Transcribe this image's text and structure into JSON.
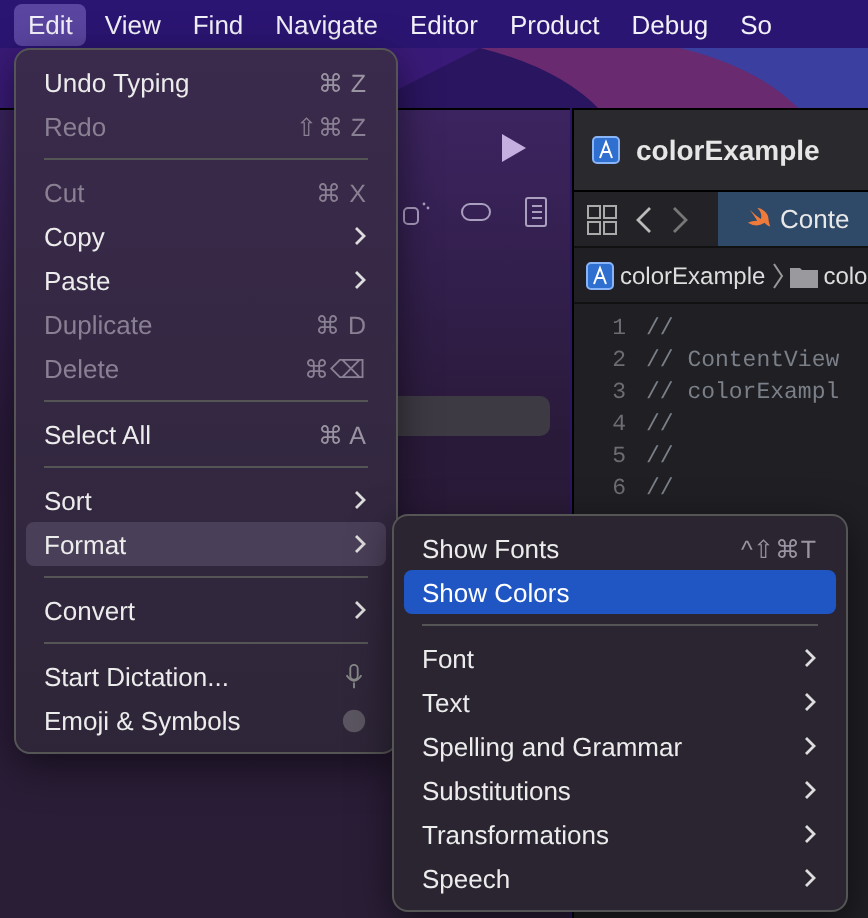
{
  "menubar": {
    "items": [
      {
        "label": "Edit",
        "selected": true
      },
      {
        "label": "View",
        "selected": false
      },
      {
        "label": "Find",
        "selected": false
      },
      {
        "label": "Navigate",
        "selected": false
      },
      {
        "label": "Editor",
        "selected": false
      },
      {
        "label": "Product",
        "selected": false
      },
      {
        "label": "Debug",
        "selected": false
      },
      {
        "label": "So",
        "selected": false
      }
    ]
  },
  "xcode": {
    "project_title": "colorExample",
    "tab": "Conte",
    "breadcrumb": [
      "colorExample",
      "colo"
    ],
    "code_lines": [
      {
        "number": "1",
        "text": "//"
      },
      {
        "number": "2",
        "text": "//  ContentView"
      },
      {
        "number": "3",
        "text": "//  colorExampl"
      },
      {
        "number": "4",
        "text": "//"
      },
      {
        "number": "5",
        "text": "//"
      },
      {
        "number": "6",
        "text": "//"
      }
    ]
  },
  "edit_menu": {
    "items": [
      {
        "kind": "item",
        "label": "Undo Typing",
        "shortcut": "⌘ Z",
        "disabled": false,
        "submenu": false,
        "selected": false
      },
      {
        "kind": "item",
        "label": "Redo",
        "shortcut": "⇧⌘ Z",
        "disabled": true,
        "submenu": false,
        "selected": false
      },
      {
        "kind": "separator"
      },
      {
        "kind": "item",
        "label": "Cut",
        "shortcut": "⌘ X",
        "disabled": true,
        "submenu": false,
        "selected": false
      },
      {
        "kind": "item",
        "label": "Copy",
        "disabled": false,
        "submenu": true,
        "selected": false
      },
      {
        "kind": "item",
        "label": "Paste",
        "disabled": false,
        "submenu": true,
        "selected": false
      },
      {
        "kind": "item",
        "label": "Duplicate",
        "shortcut": "⌘ D",
        "disabled": true,
        "submenu": false,
        "selected": false
      },
      {
        "kind": "item",
        "label": "Delete",
        "shortcut": "⌘⌫",
        "disabled": true,
        "submenu": false,
        "selected": false
      },
      {
        "kind": "separator"
      },
      {
        "kind": "item",
        "label": "Select All",
        "shortcut": "⌘ A",
        "disabled": false,
        "submenu": false,
        "selected": false
      },
      {
        "kind": "separator"
      },
      {
        "kind": "item",
        "label": "Sort",
        "disabled": false,
        "submenu": true,
        "selected": false
      },
      {
        "kind": "item",
        "label": "Format",
        "disabled": false,
        "submenu": true,
        "selected": true
      },
      {
        "kind": "separator"
      },
      {
        "kind": "item",
        "label": "Convert",
        "disabled": false,
        "submenu": true,
        "selected": false
      },
      {
        "kind": "separator"
      },
      {
        "kind": "dictation",
        "label": "Start Dictation...",
        "disabled": false,
        "submenu": false,
        "selected": false
      },
      {
        "kind": "emoji",
        "label": "Emoji & Symbols",
        "disabled": false,
        "submenu": false,
        "selected": false
      }
    ]
  },
  "format_menu": {
    "items": [
      {
        "kind": "item",
        "label": "Show Fonts",
        "shortcut": "^⇧⌘T",
        "submenu": false,
        "selected": false
      },
      {
        "kind": "item",
        "label": "Show Colors",
        "submenu": false,
        "selected": true
      },
      {
        "kind": "separator"
      },
      {
        "kind": "item",
        "label": "Font",
        "submenu": true,
        "selected": false
      },
      {
        "kind": "item",
        "label": "Text",
        "submenu": true,
        "selected": false
      },
      {
        "kind": "item",
        "label": "Spelling and Grammar",
        "submenu": true,
        "selected": false
      },
      {
        "kind": "item",
        "label": "Substitutions",
        "submenu": true,
        "selected": false
      },
      {
        "kind": "item",
        "label": "Transformations",
        "submenu": true,
        "selected": false
      },
      {
        "kind": "item",
        "label": "Speech",
        "submenu": true,
        "selected": false
      }
    ]
  }
}
